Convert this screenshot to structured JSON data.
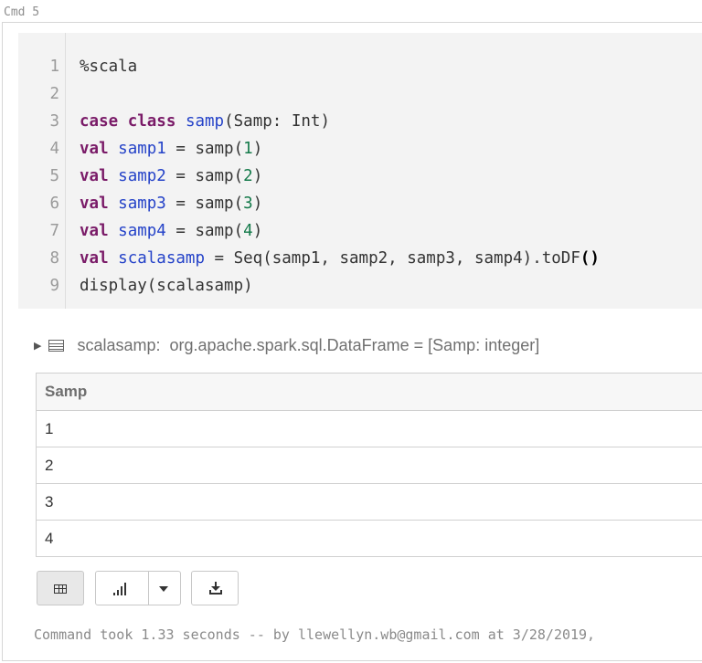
{
  "cell": {
    "label": "Cmd 5",
    "code_lines": [
      {
        "n": "1",
        "parts": [
          {
            "t": "%scala",
            "c": ""
          }
        ]
      },
      {
        "n": "2",
        "parts": []
      },
      {
        "n": "3",
        "parts": [
          {
            "t": "case",
            "c": "kw"
          },
          {
            "t": " ",
            "c": ""
          },
          {
            "t": "class",
            "c": "kw"
          },
          {
            "t": " ",
            "c": ""
          },
          {
            "t": "samp",
            "c": "def"
          },
          {
            "t": "(Samp: Int)",
            "c": ""
          }
        ]
      },
      {
        "n": "4",
        "parts": [
          {
            "t": "val",
            "c": "kw"
          },
          {
            "t": " ",
            "c": ""
          },
          {
            "t": "samp1",
            "c": "def"
          },
          {
            "t": " = samp(",
            "c": ""
          },
          {
            "t": "1",
            "c": "num"
          },
          {
            "t": ")",
            "c": ""
          }
        ]
      },
      {
        "n": "5",
        "parts": [
          {
            "t": "val",
            "c": "kw"
          },
          {
            "t": " ",
            "c": ""
          },
          {
            "t": "samp2",
            "c": "def"
          },
          {
            "t": " = samp(",
            "c": ""
          },
          {
            "t": "2",
            "c": "num"
          },
          {
            "t": ")",
            "c": ""
          }
        ]
      },
      {
        "n": "6",
        "parts": [
          {
            "t": "val",
            "c": "kw"
          },
          {
            "t": " ",
            "c": ""
          },
          {
            "t": "samp3",
            "c": "def"
          },
          {
            "t": " = samp(",
            "c": ""
          },
          {
            "t": "3",
            "c": "num"
          },
          {
            "t": ")",
            "c": ""
          }
        ]
      },
      {
        "n": "7",
        "parts": [
          {
            "t": "val",
            "c": "kw"
          },
          {
            "t": " ",
            "c": ""
          },
          {
            "t": "samp4",
            "c": "def"
          },
          {
            "t": " = samp(",
            "c": ""
          },
          {
            "t": "4",
            "c": "num"
          },
          {
            "t": ")",
            "c": ""
          }
        ]
      },
      {
        "n": "8",
        "parts": [
          {
            "t": "val",
            "c": "kw"
          },
          {
            "t": " ",
            "c": ""
          },
          {
            "t": "scalasamp",
            "c": "def"
          },
          {
            "t": " = Seq(samp1, samp2, samp3, samp4).toDF",
            "c": ""
          },
          {
            "t": "()",
            "c": "paren-bold"
          }
        ]
      },
      {
        "n": "9",
        "parts": [
          {
            "t": "display(scalasamp)",
            "c": ""
          }
        ]
      }
    ],
    "output": {
      "df_name": "scalasamp:",
      "df_type": "org.apache.spark.sql.DataFrame = [Samp: integer]",
      "table": {
        "header": "Samp",
        "rows": [
          "1",
          "2",
          "3",
          "4"
        ]
      }
    },
    "toolbar": {
      "icons": [
        "table-icon",
        "bar-chart-icon",
        "caret-down-icon",
        "download-icon"
      ]
    },
    "footer": "Command took 1.33 seconds -- by llewellyn.wb@gmail.com at 3/28/2019,"
  },
  "colors": {
    "keyword": "#7a1b68",
    "definition": "#2442c8",
    "number": "#147a4a",
    "editor_bg": "#f3f3f3"
  }
}
